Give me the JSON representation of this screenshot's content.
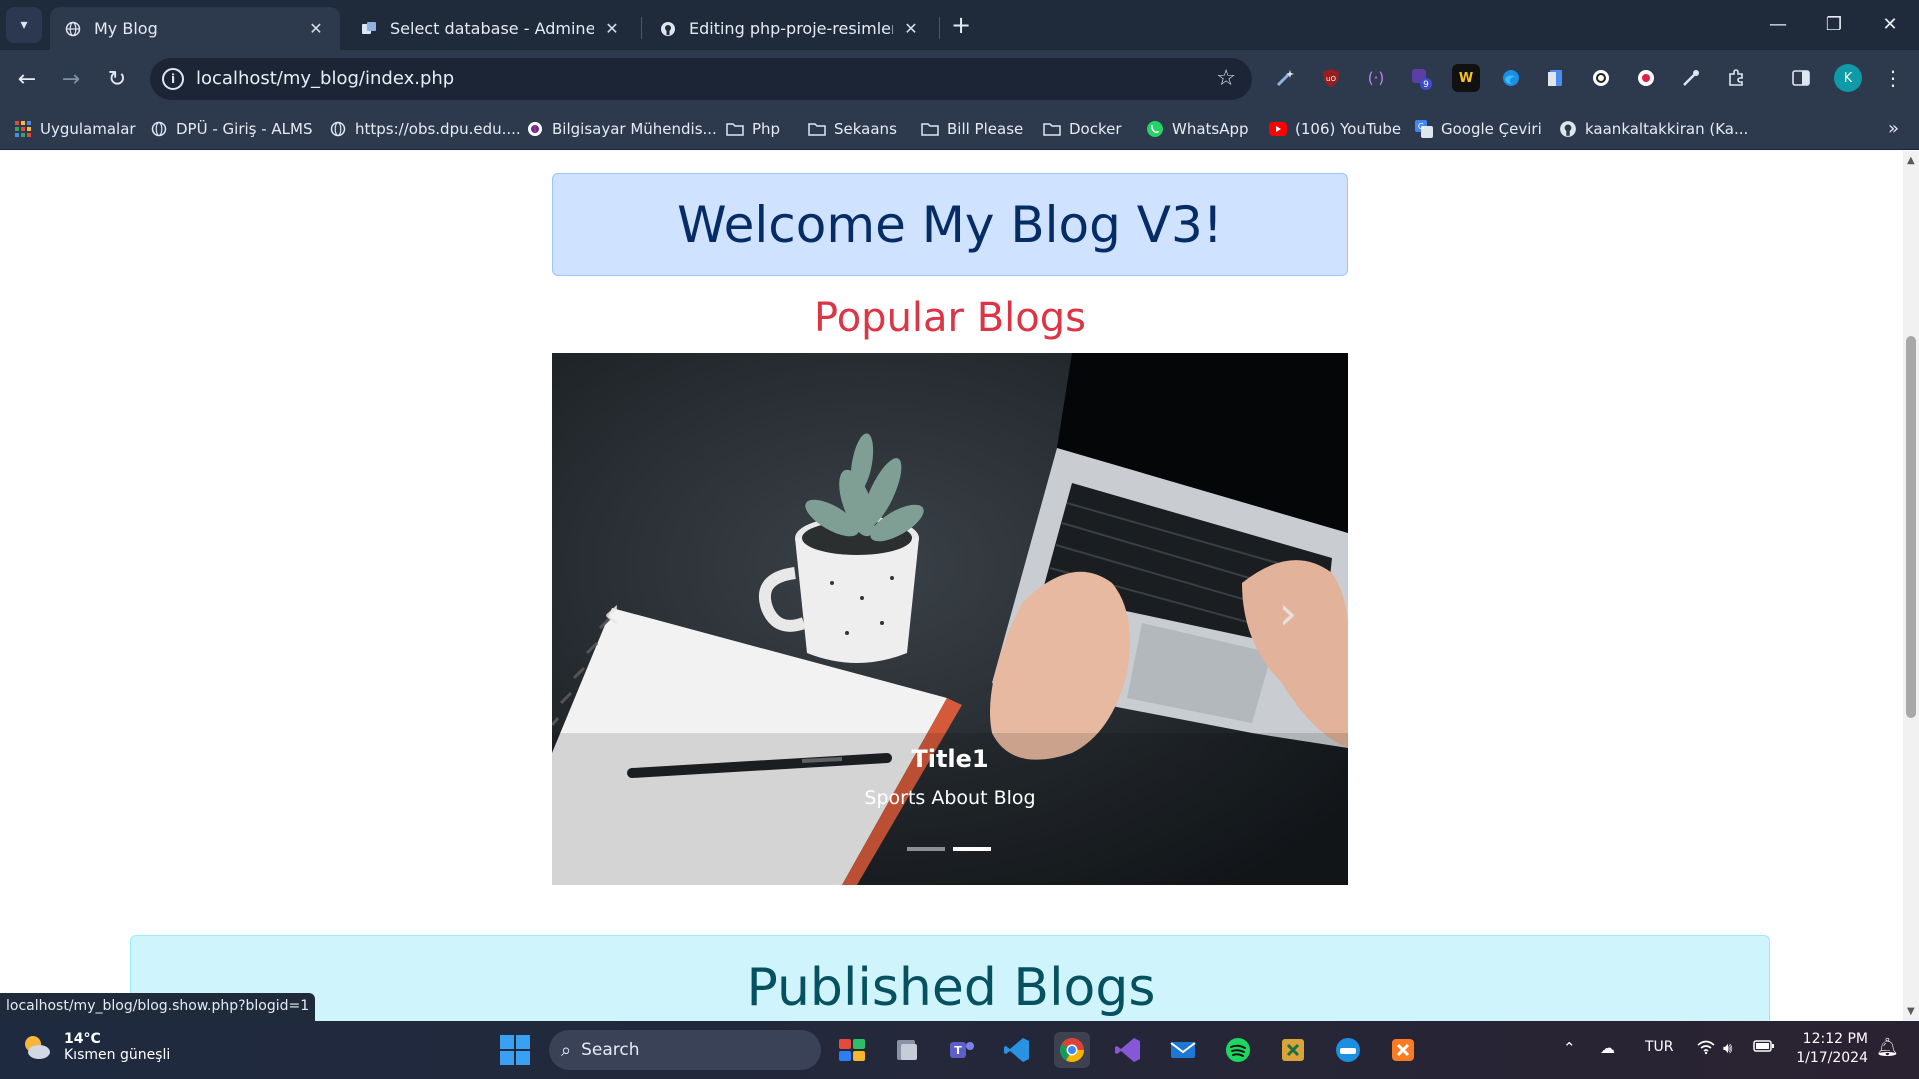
{
  "tabs": [
    {
      "label": "My Blog",
      "icon": "globe-icon",
      "active": true
    },
    {
      "label": "Select database - Adminer",
      "icon": "adminer-icon",
      "active": false
    },
    {
      "label": "Editing php-proje-resimleri/blo",
      "icon": "github-icon",
      "active": false
    }
  ],
  "address_bar": {
    "url": "localhost/my_blog/index.php"
  },
  "extensions": [
    "wand-icon",
    "ublock-icon",
    "brackets-icon",
    "puzzle-badge-icon",
    "w-icon",
    "edge-icon",
    "docs-icon",
    "circle-icon",
    "record-icon",
    "eyedropper-icon",
    "extensions-icon",
    "sidebar-icon",
    "profile-icon",
    "menu-icon"
  ],
  "profile_initial": "K",
  "extension_badge": "9",
  "bookmarks": [
    {
      "label": "Uygulamalar",
      "icon": "apps-grid-icon"
    },
    {
      "label": "DPÜ - Giriş - ALMS",
      "icon": "globe-icon"
    },
    {
      "label": "https://obs.dpu.edu....",
      "icon": "globe-icon"
    },
    {
      "label": "Bilgisayar Mühendis...",
      "icon": "university-icon"
    },
    {
      "label": "Php",
      "icon": "folder-icon"
    },
    {
      "label": "Sekaans",
      "icon": "folder-icon"
    },
    {
      "label": "Bill Please",
      "icon": "folder-icon"
    },
    {
      "label": "Docker",
      "icon": "folder-icon"
    },
    {
      "label": "WhatsApp",
      "icon": "whatsapp-icon"
    },
    {
      "label": "(106) YouTube",
      "icon": "youtube-icon"
    },
    {
      "label": "Google Çeviri",
      "icon": "translate-icon"
    },
    {
      "label": "kaankaltakkiran (Ka...",
      "icon": "github-icon"
    }
  ],
  "page": {
    "welcome_title": "Welcome My Blog V3!",
    "popular_heading": "Popular Blogs",
    "carousel": {
      "slide_title": "Title1",
      "slide_caption": "Sports About Blog",
      "slide_count": 2,
      "active_slide": 2
    },
    "published_heading": "Published Blogs"
  },
  "status_bar": {
    "url": "localhost/my_blog/blog.show.php?blogid=1"
  },
  "taskbar": {
    "weather_temp": "14°C",
    "weather_desc": "Kısmen güneşli",
    "search_label": "Search",
    "apps": [
      "widgets-icon",
      "office-icon",
      "files-icon",
      "teams-icon",
      "vscode-icon",
      "chrome-icon",
      "visual-studio-icon",
      "mail-icon",
      "spotify-icon",
      "excel-icon",
      "docker-icon",
      "xampp-icon"
    ],
    "language": "TUR",
    "time": "12:12 PM",
    "date": "1/17/2024"
  },
  "colors": {
    "welcome_bg": "#cfe2ff",
    "welcome_text": "#052c65",
    "popular_text": "#dc3545",
    "published_bg": "#cff4fc",
    "published_text": "#055160"
  }
}
